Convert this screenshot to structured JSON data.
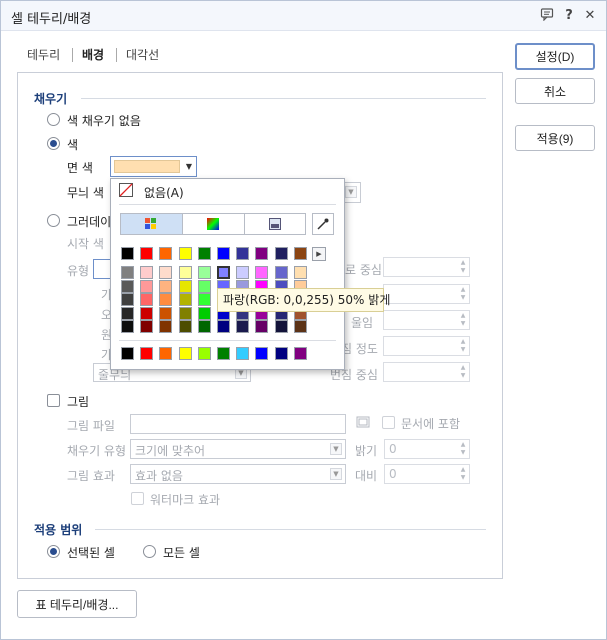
{
  "window": {
    "title": "셀 테두리/배경"
  },
  "titlebar_icons": [
    "comment-icon",
    "help-icon",
    "close-icon"
  ],
  "titlebar_glyphs": {
    "help": "?",
    "close": "✕"
  },
  "tabs": [
    {
      "label": "테두리",
      "active": false
    },
    {
      "label": "배경",
      "active": true
    },
    {
      "label": "대각선",
      "active": false
    }
  ],
  "buttons": {
    "ok": "설정(D)",
    "cancel": "취소",
    "apply": "적용(9)",
    "table_border": "표 테두리/배경..."
  },
  "fill": {
    "section": "채우기",
    "no_fill": "색 채우기 없음",
    "color": "색",
    "face_color_label": "면 색",
    "pattern_color_label": "무늬 색",
    "gradient": "그러데이션",
    "start_color": "시작 색",
    "type": "유형",
    "h_center": "가로 중심",
    "slope": "기울임",
    "spread": "번짐 정도",
    "spread_center": "번짐 중심",
    "face_color_value": "#ffdfb0"
  },
  "picture": {
    "label": "그림",
    "file_label": "그림 파일",
    "include_in_doc": "문서에 포함",
    "fill_type_label": "채우기 유형",
    "fill_type_value": "크기에 맞추어",
    "brightness_label": "밝기",
    "brightness_value": "0",
    "effect_label": "그림 효과",
    "effect_value": "효과 없음",
    "contrast_label": "대비",
    "contrast_value": "0",
    "watermark": "워터마크 효과"
  },
  "scope": {
    "section": "적용 범위",
    "selected": "선택된 셀",
    "all": "모든 셀"
  },
  "color_popup": {
    "none_label": "없음(A)",
    "tooltip": "파랑(RGB: 0,0,255) 50% 밝게",
    "top_row": [
      "#000000",
      "#ff0000",
      "#ff6600",
      "#ffff00",
      "#008000",
      "#0000ff",
      "#333399",
      "#800080",
      "#1f1f5f",
      "#8b4513"
    ],
    "shades": [
      [
        "#808080",
        "#ffcccc",
        "#ffdccc",
        "#ffff99",
        "#99ff99",
        "#8080ff",
        "#ccccff",
        "#ff66ff",
        "#6666cc",
        "#ffdfb0"
      ],
      [
        "#595959",
        "#ff9999",
        "#ffb380",
        "#e6e600",
        "#66ff66",
        "#6666ff",
        "#9999dd",
        "#ff00ff",
        "#4d4dbf",
        "#ffcc99"
      ],
      [
        "#404040",
        "#ff6666",
        "#ff8c40",
        "#b3b300",
        "#33ff33",
        "#3333ff",
        "#6666bb",
        "#cc00cc",
        "#333399",
        "#e69950"
      ],
      [
        "#262626",
        "#cc0000",
        "#cc5200",
        "#808000",
        "#00cc00",
        "#0000cc",
        "#333380",
        "#990099",
        "#262673",
        "#a0522d"
      ],
      [
        "#0d0d0d",
        "#800000",
        "#803300",
        "#4d4d00",
        "#006600",
        "#000080",
        "#1a1a4d",
        "#660066",
        "#13133a",
        "#5c3317"
      ]
    ],
    "recent": [
      "#000000",
      "#ff0000",
      "#ff6600",
      "#ffff00",
      "#99ff00",
      "#008000",
      "#33ccff",
      "#0000ff",
      "#000080",
      "#800080"
    ],
    "selected_index": [
      0,
      5
    ]
  },
  "partial_labels": {
    "gradient_clip": "그러데이",
    "type_clip": "유형",
    "row_labels": [
      "가",
      "오",
      "원",
      "가"
    ],
    "last_combo": "줄무늬",
    "h_center_clip": "로 중심",
    "slope_clip": "울임",
    "spread_clip": "짐 정도",
    "spread_center_clip": "번짐 중심"
  }
}
